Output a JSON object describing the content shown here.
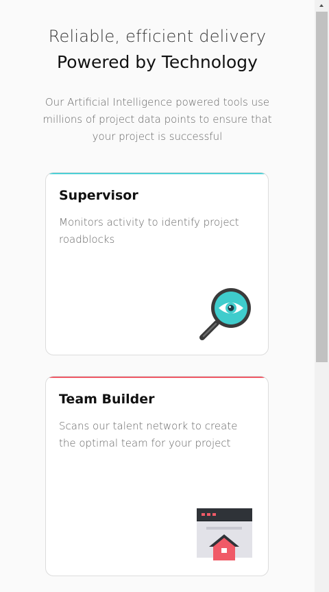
{
  "header": {
    "line1": "Reliable, efficient delivery",
    "line2": "Powered by Technology"
  },
  "intro": {
    "text": "Our Artificial Intelligence powered tools use millions of project data points to ensure that your project is successful"
  },
  "cards": [
    {
      "title": "Supervisor",
      "description": "Monitors activity to identify project roadblocks",
      "accent_color": "#4dd0d6",
      "icon": "magnifier-eye-icon"
    },
    {
      "title": "Team Builder",
      "description": "Scans our talent network to create the optimal team for your project",
      "accent_color": "#f05a67",
      "icon": "browser-house-icon"
    }
  ],
  "colors": {
    "background": "#fafafa",
    "card_background": "#ffffff",
    "teal_accent": "#4dd0d6",
    "red_accent": "#f05a67"
  }
}
